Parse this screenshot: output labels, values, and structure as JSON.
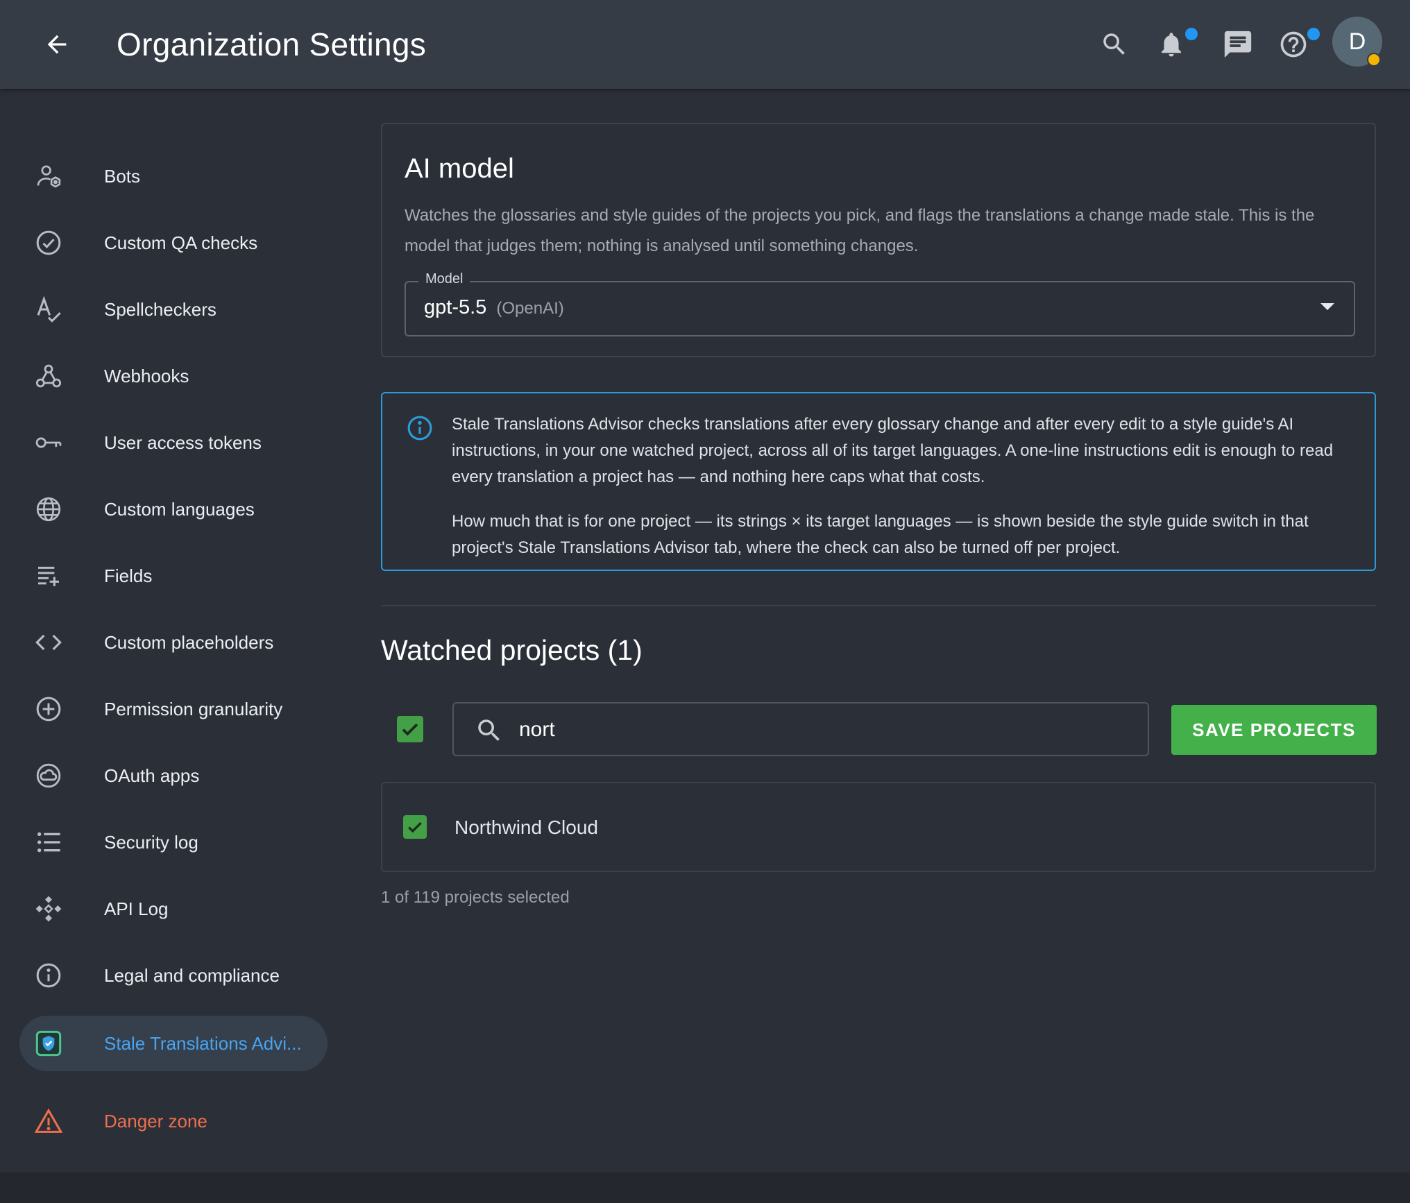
{
  "header": {
    "title": "Organization Settings",
    "back_icon": "arrow-left-icon",
    "icons": [
      "search-icon",
      "bell-icon",
      "chat-icon",
      "help-icon"
    ],
    "avatar_initial": "D"
  },
  "sidebar": {
    "items": [
      {
        "label": "Bots",
        "icon": "bot-icon"
      },
      {
        "label": "Custom QA checks",
        "icon": "check-circle-icon"
      },
      {
        "label": "Spellcheckers",
        "icon": "spellcheck-icon"
      },
      {
        "label": "Webhooks",
        "icon": "webhook-icon"
      },
      {
        "label": "User access tokens",
        "icon": "key-icon"
      },
      {
        "label": "Custom languages",
        "icon": "globe-icon"
      },
      {
        "label": "Fields",
        "icon": "playlist-add-icon"
      },
      {
        "label": "Custom placeholders",
        "icon": "code-icon"
      },
      {
        "label": "Permission granularity",
        "icon": "plus-circle-icon"
      },
      {
        "label": "OAuth apps",
        "icon": "cloud-circle-icon"
      },
      {
        "label": "Security log",
        "icon": "list-icon"
      },
      {
        "label": "API Log",
        "icon": "api-icon"
      },
      {
        "label": "Legal and compliance",
        "icon": "info-circle-icon"
      },
      {
        "label": "Stale Translations Advi...",
        "icon": "shield-app-icon"
      },
      {
        "label": "Danger zone",
        "icon": "warning-icon"
      }
    ]
  },
  "ai_model": {
    "title": "AI model",
    "description": "Watches the glossaries and style guides of the projects you pick, and flags the translations a change made stale. This is the model that judges them; nothing is analysed until something changes.",
    "model_label": "Model",
    "model_value": "gpt-5.5",
    "model_vendor": "(OpenAI)"
  },
  "info": {
    "paragraph_1": "Stale Translations Advisor checks translations after every glossary change and after every edit to a style guide's AI instructions, in your one watched project, across all of its target languages. A one-line instructions edit is enough to read every translation a project has — and nothing here caps what that costs.",
    "paragraph_2": "How much that is for one project — its strings × its target languages — is shown beside the style guide switch in that project's Stale Translations Advisor tab, where the check can also be turned off per project."
  },
  "watched": {
    "title": "Watched projects (1)",
    "search_value": "nort",
    "save_label": "SAVE PROJECTS",
    "projects": [
      {
        "name": "Northwind Cloud",
        "checked": true
      }
    ],
    "selection_text": "1 of 119 projects selected"
  },
  "colors": {
    "accent_blue": "#2d9bd8",
    "success_green": "#43b04a",
    "danger_red": "#ef6e4e"
  }
}
